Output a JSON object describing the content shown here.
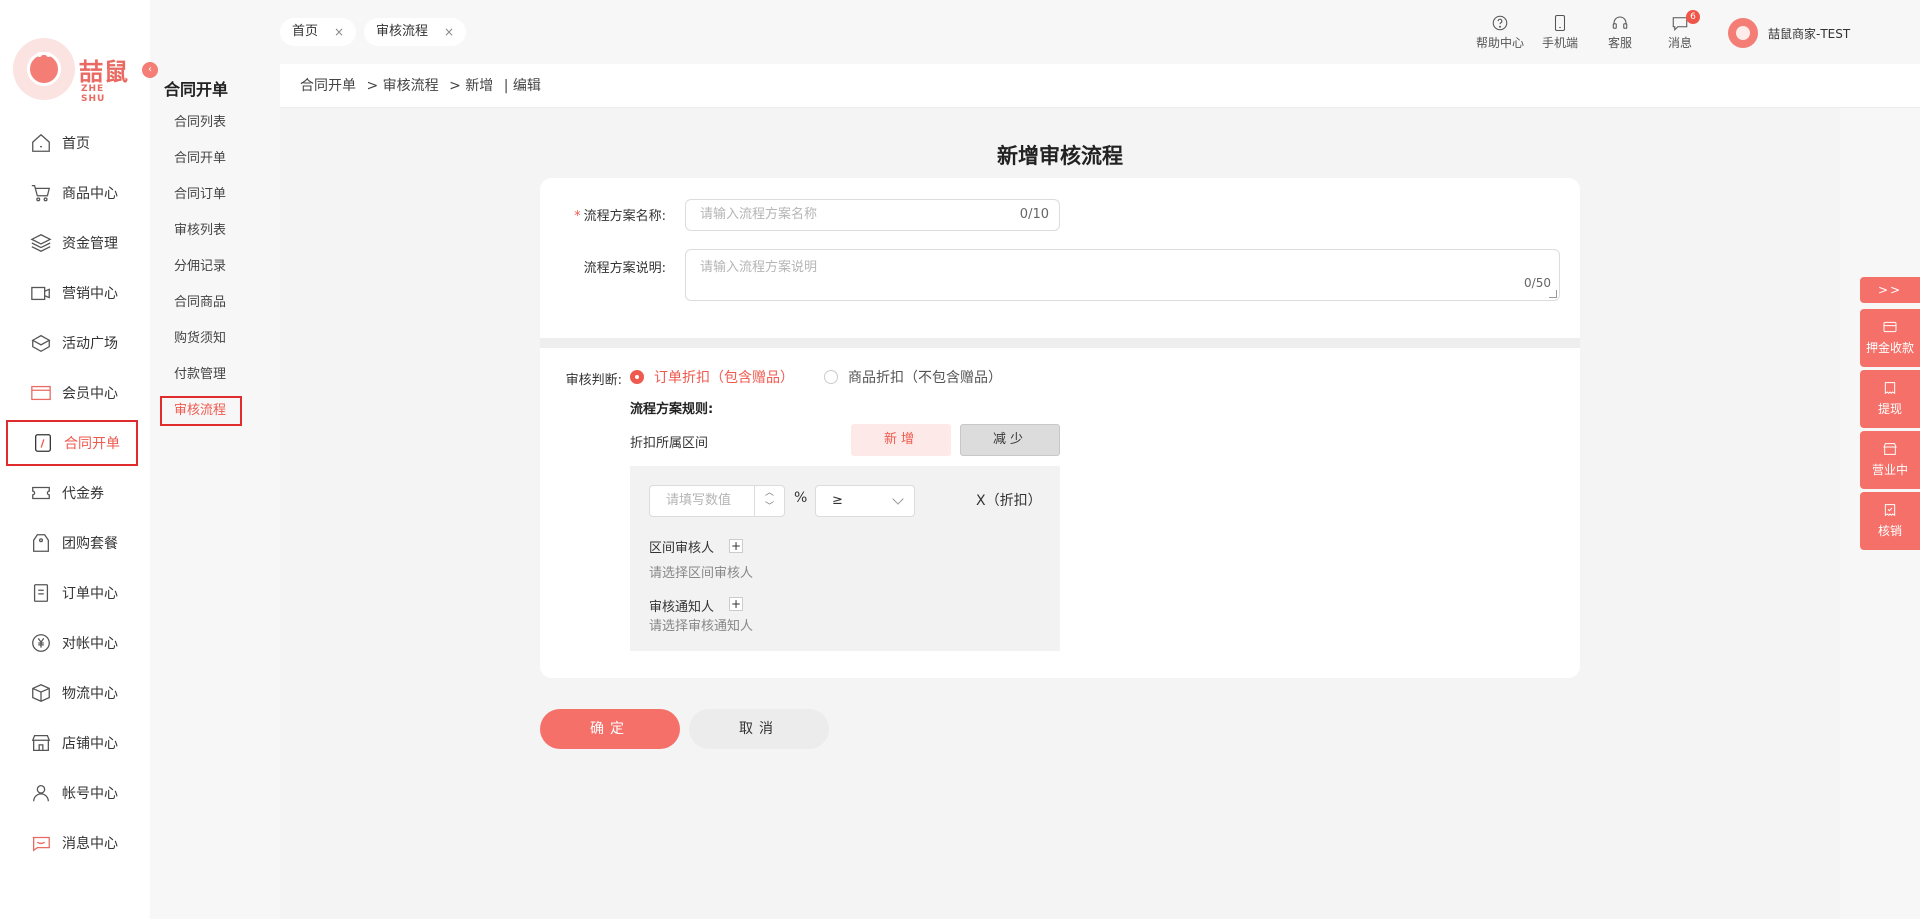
{
  "brand": {
    "name_cn": "喆鼠",
    "name_en": "ZHE SHU"
  },
  "nav": [
    {
      "label": "首页",
      "icon": "home-icon"
    },
    {
      "label": "商品中心",
      "icon": "cart-icon"
    },
    {
      "label": "资金管理",
      "icon": "layers-icon"
    },
    {
      "label": "营销中心",
      "icon": "marketing-icon"
    },
    {
      "label": "活动广场",
      "icon": "box-icon"
    },
    {
      "label": "会员中心",
      "icon": "vip-icon"
    },
    {
      "label": "合同开单",
      "icon": "contract-icon",
      "active": true
    },
    {
      "label": "代金券",
      "icon": "ticket-icon"
    },
    {
      "label": "团购套餐",
      "icon": "tag-icon"
    },
    {
      "label": "订单中心",
      "icon": "order-icon"
    },
    {
      "label": "对帐中心",
      "icon": "yen-icon"
    },
    {
      "label": "物流中心",
      "icon": "package-icon"
    },
    {
      "label": "店铺中心",
      "icon": "store-icon"
    },
    {
      "label": "帐号中心",
      "icon": "user-icon"
    },
    {
      "label": "消息中心",
      "icon": "message-icon"
    }
  ],
  "subnav": {
    "title": "合同开单",
    "items": [
      "合同列表",
      "合同开单",
      "合同订单",
      "审核列表",
      "分佣记录",
      "合同商品",
      "购货须知",
      "付款管理",
      "审核流程"
    ],
    "active_index": 8
  },
  "tabs": [
    {
      "label": "首页",
      "close": "×"
    },
    {
      "label": "审核流程",
      "close": "×"
    }
  ],
  "tools": [
    {
      "label": "帮助中心",
      "icon": "help-icon"
    },
    {
      "label": "手机端",
      "icon": "phone-icon"
    },
    {
      "label": "客服",
      "icon": "headset-icon"
    },
    {
      "label": "消息",
      "icon": "chat-icon",
      "badge": "6"
    }
  ],
  "user": {
    "name": "喆鼠商家-TEST"
  },
  "breadcrumb": [
    "合同开单",
    "> 审核流程",
    "> 新增",
    "| 编辑"
  ],
  "form": {
    "title": "新增审核流程",
    "name_required": "*",
    "name_label": "流程方案名称:",
    "name_placeholder": "请输入流程方案名称",
    "name_count": "0/10",
    "desc_label": "流程方案说明:",
    "desc_placeholder": "请输入流程方案说明",
    "desc_count": "0/50",
    "judge_label": "审核判断:",
    "radio_order": "订单折扣（包含赠品）",
    "radio_goods": "商品折扣（不包含赠品）",
    "rules_label": "流程方案规则:",
    "range_label": "折扣所属区间",
    "add_btn": "新增",
    "reduce_btn": "减少",
    "value_placeholder": "请填写数值",
    "percent": "%",
    "operator": "≥",
    "x_label": "X（折扣）",
    "approver_label": "区间审核人",
    "approver_hint": "请选择区间审核人",
    "notifier_label": "审核通知人",
    "notifier_hint": "请选择审核通知人",
    "plus": "+",
    "ok": "确定",
    "cancel": "取消"
  },
  "float": {
    "toggle": ">>",
    "items": [
      {
        "label": "押金收款",
        "icon": "card-icon"
      },
      {
        "label": "提现",
        "icon": "withdraw-icon"
      },
      {
        "label": "营业中",
        "icon": "shop-icon"
      },
      {
        "label": "核销",
        "icon": "verify-icon"
      }
    ]
  },
  "colors": {
    "accent": "#f47068",
    "active_border": "#e02c2c"
  }
}
